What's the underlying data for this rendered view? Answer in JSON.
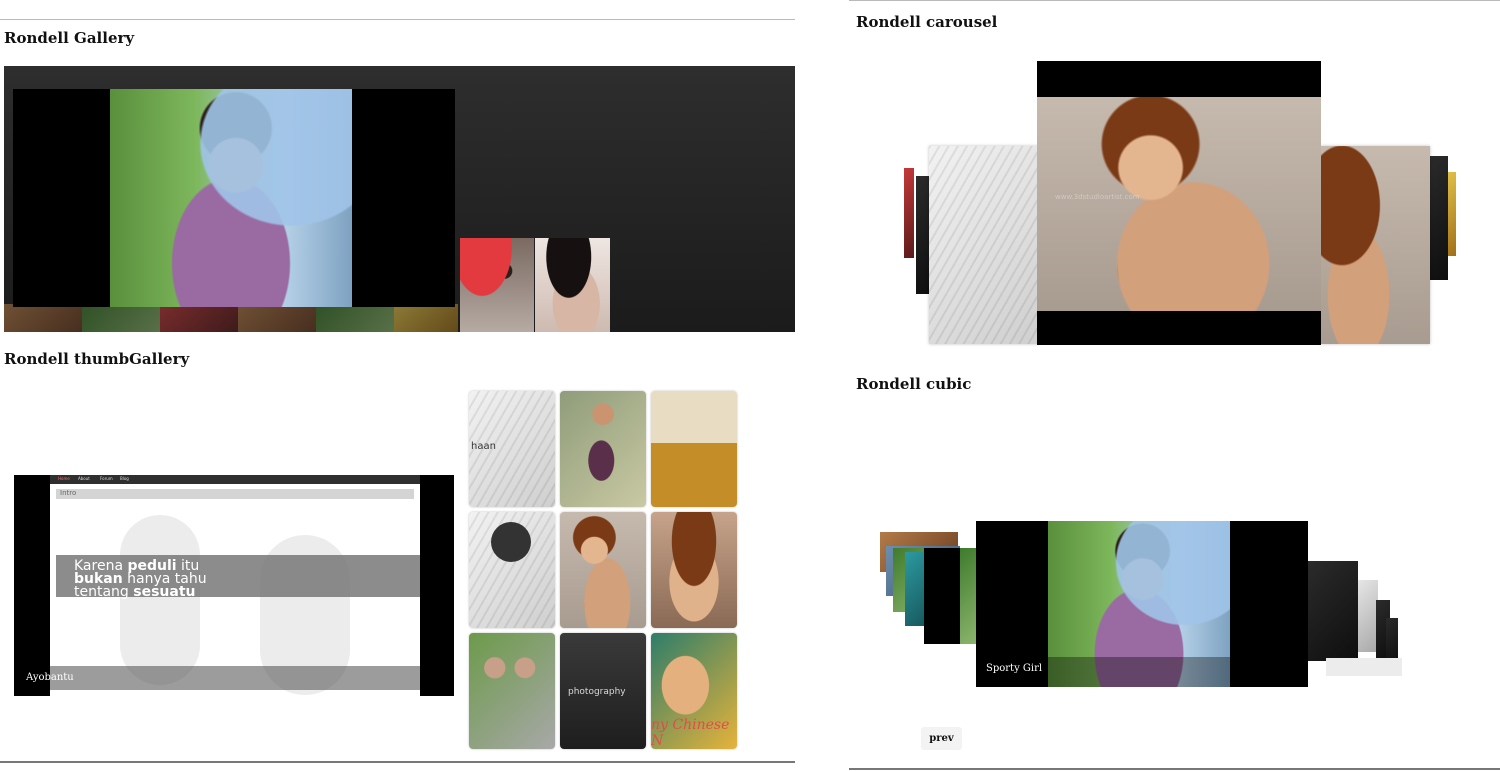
{
  "sections": {
    "gallery": {
      "title": "Rondell Gallery"
    },
    "thumb_gallery": {
      "title": "Rondell thumbGallery"
    },
    "carousel": {
      "title": "Rondell carousel"
    },
    "cubic": {
      "title": "Rondell cubic"
    }
  },
  "thumb_gallery_preview": {
    "site_nav": [
      "Home",
      "About",
      "Forum",
      "Blog"
    ],
    "tab_label": "Intro",
    "banner": {
      "line1_a": "Karena ",
      "line1_b": "peduli",
      "line1_c": " itu",
      "line2_a": "bukan",
      "line2_b": " hanya tahu",
      "line3_a": "tentang ",
      "line3_b": "sesuatu"
    },
    "caption": "Ayobantu"
  },
  "thumb_grid": {
    "tile_1_text": "haan",
    "tile_8_text": "photography",
    "tile_9_text": "ny Chinese N"
  },
  "cubic": {
    "caption": "Sporty Girl",
    "prev_label": "prev"
  },
  "carousel": {
    "watermark": "www.3dstudioartist.com"
  },
  "colors": {
    "gallery_bg": "#1b1b1b",
    "caption_text": "#ffffff"
  }
}
